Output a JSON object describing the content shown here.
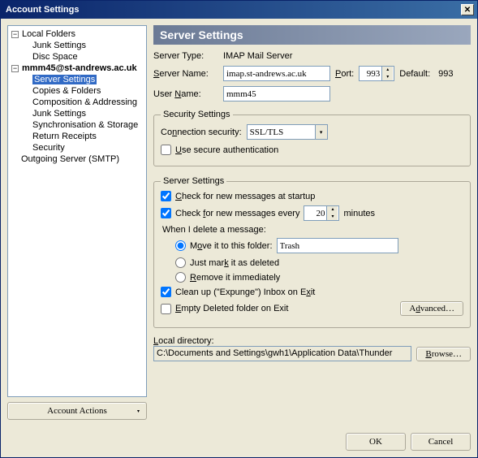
{
  "window": {
    "title": "Account Settings"
  },
  "tree": {
    "accounts": [
      {
        "name": "Local Folders",
        "children": [
          "Junk Settings",
          "Disc Space"
        ]
      },
      {
        "name": "mmm45@st-andrews.ac.uk",
        "children": [
          "Server Settings",
          "Copies & Folders",
          "Composition & Addressing",
          "Junk Settings",
          "Synchronisation & Storage",
          "Return Receipts",
          "Security"
        ]
      }
    ],
    "outgoing": "Outgoing Server (SMTP)",
    "account_actions": "Account Actions"
  },
  "panel": {
    "heading": "Server Settings",
    "server_type_label": "Server Type:",
    "server_type_value": "IMAP Mail Server",
    "server_name_label": "Server Name:",
    "server_name_value": "imap.st-andrews.ac.uk",
    "port_label": "Port:",
    "port_value": "993",
    "default_label": "Default:",
    "default_value": "993",
    "user_name_label": "User Name:",
    "user_name_value": "mmm45",
    "security": {
      "legend": "Security Settings",
      "conn_label": "Connection security:",
      "conn_value": "SSL/TLS",
      "use_secure": "Use secure authentication"
    },
    "server": {
      "legend": "Server Settings",
      "check_startup": "Check for new messages at startup",
      "check_every_pre": "Check for new messages every",
      "check_every_value": "20",
      "check_every_post": "minutes",
      "when_delete": "When I delete a message:",
      "opt_move": "Move it to this folder:",
      "opt_move_value": "Trash",
      "opt_mark": "Just mark it as deleted",
      "opt_remove": "Remove it immediately",
      "cleanup": "Clean up (\"Expunge\") Inbox on Exit",
      "empty": "Empty Deleted folder on Exit",
      "advanced": "Advanced…"
    },
    "local_dir_label": "Local directory:",
    "local_dir_value": "C:\\Documents and Settings\\gwh1\\Application Data\\Thunder",
    "browse": "Browse…"
  },
  "footer": {
    "ok": "OK",
    "cancel": "Cancel"
  }
}
